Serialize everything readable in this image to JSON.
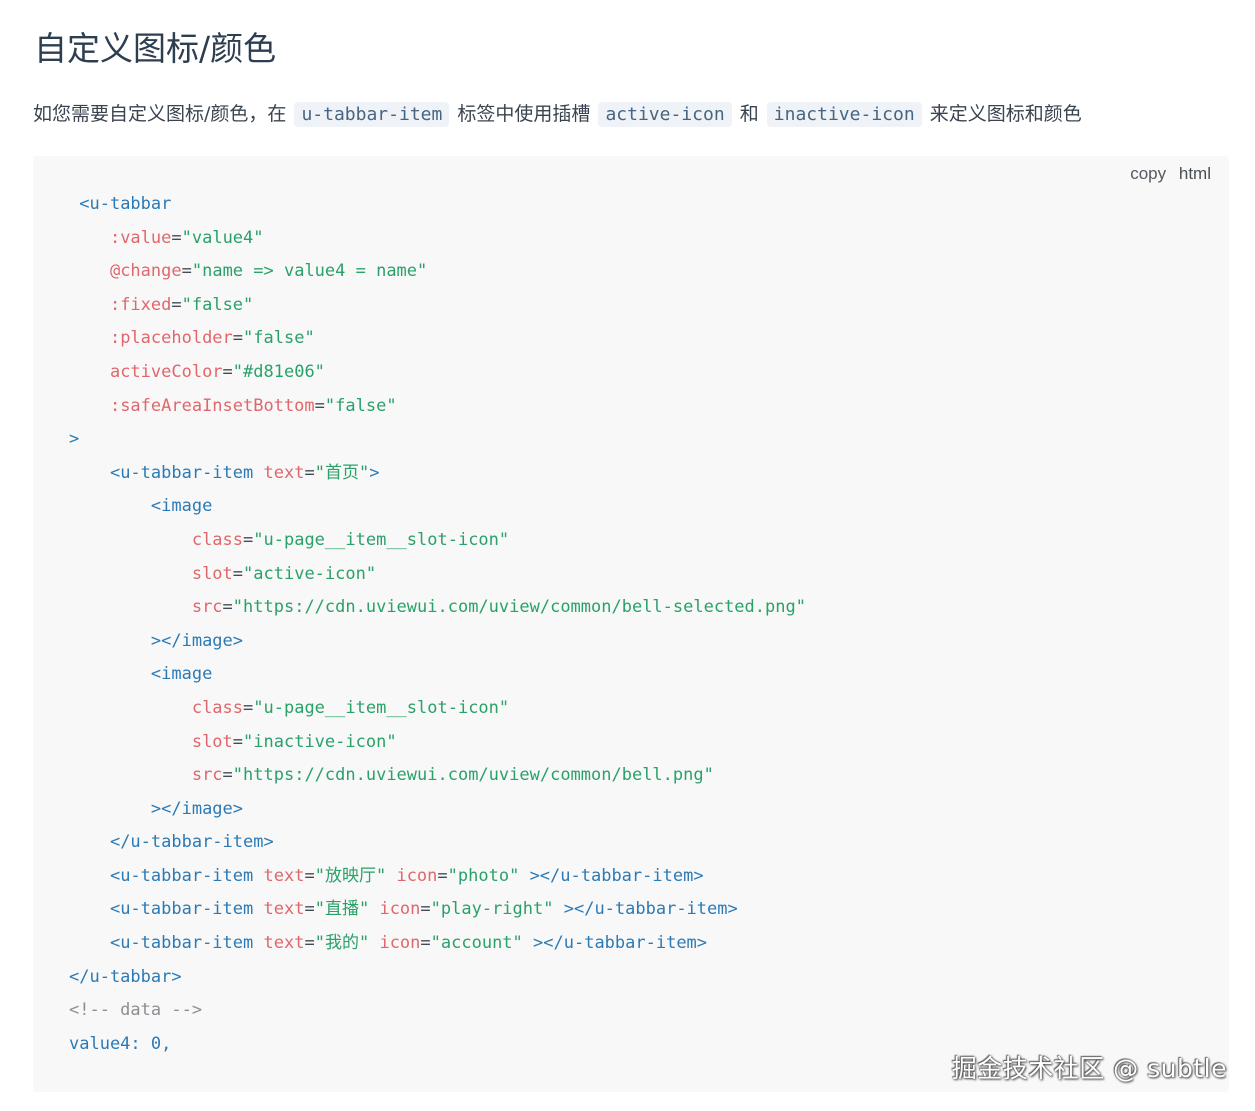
{
  "heading": "自定义图标/颜色",
  "intro": {
    "text1": "如您需要自定义图标/颜色，在",
    "code1": "u-tabbar-item",
    "text2": "标签中使用插槽",
    "code2": "active-icon",
    "text3": "和",
    "code3": "inactive-icon",
    "text4": "来定义图标和颜色"
  },
  "code_toolbar": {
    "copy_label": "copy",
    "language": "html"
  },
  "code": {
    "l1_tag": "<u-tabbar",
    "l2_attr": ":value",
    "l2_val": "\"value4\"",
    "l3_attr": "@change",
    "l3_val": "\"name => value4 = name\"",
    "l4_attr": ":fixed",
    "l4_val": "\"false\"",
    "l5_attr": ":placeholder",
    "l5_val": "\"false\"",
    "l6_attr": "activeColor",
    "l6_val": "\"#d81e06\"",
    "l7_attr": ":safeAreaInsetBottom",
    "l7_val": "\"false\"",
    "l8_close": ">",
    "l9_tag": "<u-tabbar-item",
    "l9_attr": "text",
    "l9_val_q1": "\"",
    "l9_val_cjk": "首页",
    "l9_val_q2": "\"",
    "l9_end": ">",
    "l10_tag": "<image",
    "l11_attr": "class",
    "l11_val": "\"u-page__item__slot-icon\"",
    "l12_attr": "slot",
    "l12_val": "\"active-icon\"",
    "l13_attr": "src",
    "l13_val": "\"https://cdn.uviewui.com/uview/common/bell-selected.png\"",
    "l14_tag": "></image>",
    "l15_tag": "<image",
    "l16_attr": "class",
    "l16_val": "\"u-page__item__slot-icon\"",
    "l17_attr": "slot",
    "l17_val": "\"inactive-icon\"",
    "l18_attr": "src",
    "l18_val": "\"https://cdn.uviewui.com/uview/common/bell.png\"",
    "l19_tag": "></image>",
    "l20_tag": "</u-tabbar-item>",
    "l21_tag": "<u-tabbar-item",
    "l21_attr1": "text",
    "l21_cjk": "放映厅",
    "l21_attr2": "icon",
    "l21_val2": "\"photo\"",
    "l21_end": "></u-tabbar-item>",
    "l22_tag": "<u-tabbar-item",
    "l22_attr1": "text",
    "l22_cjk": "直播",
    "l22_attr2": "icon",
    "l22_val2": "\"play-right\"",
    "l22_end": "></u-tabbar-item>",
    "l23_tag": "<u-tabbar-item",
    "l23_attr1": "text",
    "l23_cjk": "我的",
    "l23_attr2": "icon",
    "l23_val2": "\"account\"",
    "l23_end": "></u-tabbar-item>",
    "l24_tag": "</u-tabbar>",
    "l25_comment": "<!-- data -->",
    "l26_text": "value4: 0,"
  },
  "watermark": "掘金技术社区 @ subtle"
}
